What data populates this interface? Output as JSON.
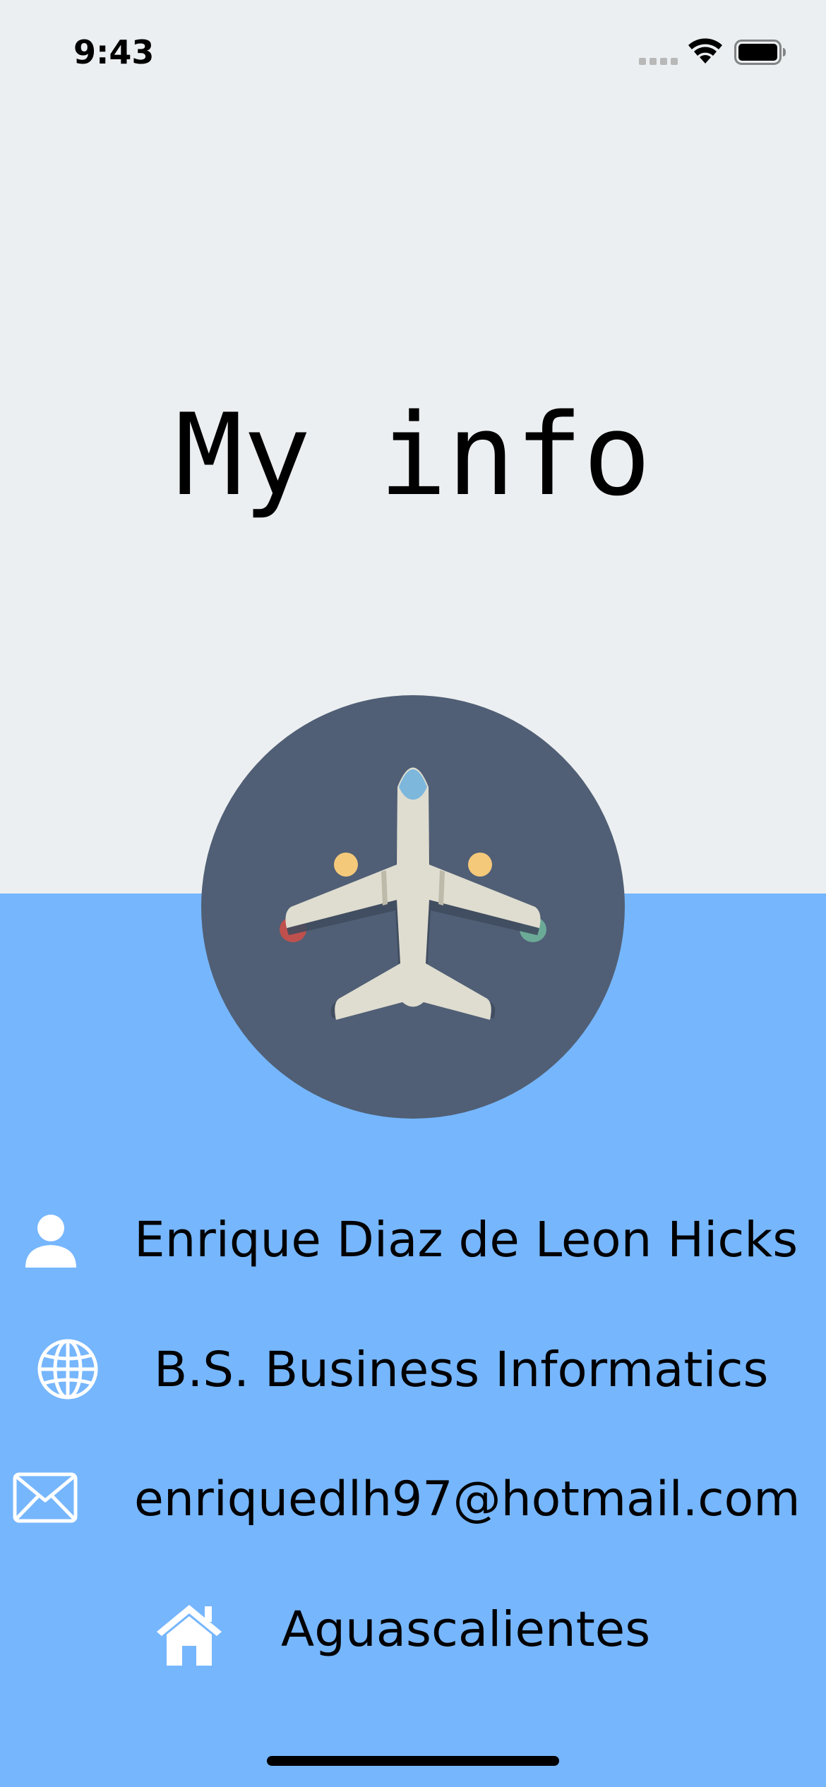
{
  "status_bar": {
    "time": "9:43"
  },
  "header": {
    "title": "My info"
  },
  "avatar": {
    "icon": "airplane-icon",
    "background_color": "#505F75"
  },
  "info": {
    "name": {
      "icon": "person-icon",
      "text": "Enrique Diaz de Leon Hicks"
    },
    "degree": {
      "icon": "globe-icon",
      "text": "B.S. Business Informatics"
    },
    "email": {
      "icon": "envelope-icon",
      "text": "enriquedlh97@hotmail.com"
    },
    "city": {
      "icon": "home-icon",
      "text": "Aguascalientes"
    }
  },
  "colors": {
    "top_background": "#ECEFF1",
    "bottom_background": "#76B6FD",
    "text": "#000000",
    "icon": "#FFFFFF"
  }
}
